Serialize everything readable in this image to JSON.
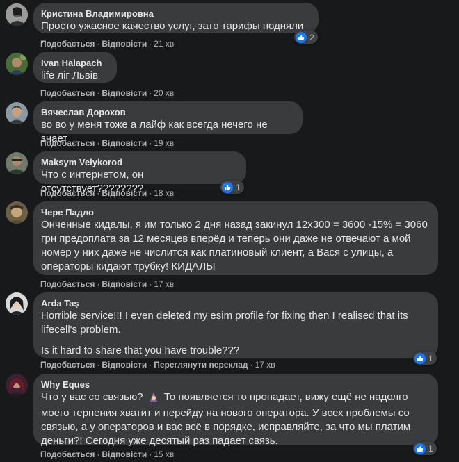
{
  "actions": {
    "like": "Подобається",
    "reply": "Відповісти",
    "translate": "Переглянути переклад",
    "sep": "·"
  },
  "comments": [
    {
      "author": "Кристина Владимировна",
      "text": "Просто ужасное качество услуг, зато тарифы подняли ...",
      "time": "21 хв",
      "reactions": "2"
    },
    {
      "author": "Ivan Halapach",
      "text": "life ліг Львів",
      "time": "20 хв"
    },
    {
      "author": "Вячеслав Дорохов",
      "text": "во во у меня тоже а лайф как всегда нечего не знает",
      "time": "19 хв"
    },
    {
      "author": "Maksym Velykorod",
      "text": "Что с интернетом, он отсутствует????????",
      "time": "18 хв",
      "reactions": "1"
    },
    {
      "author": "Чере Падло",
      "text": "Онченные кидалы, я им только 2 дня назад закинул 12х300 = 3600 -15% = 3060 грн предоплата за 12 месяцев вперёд и теперь они даже не отвечают а мой номер у них даже не числится как платиновый клиент, а Вася с улицы, а операторы кидают трубку! КИДАЛЫ",
      "time": "17 хв"
    },
    {
      "author": "Arda Taş",
      "text": "Horrible service!!! I even deleted my esim profile for fixing then I realised that its lifecell's problem.",
      "text2": "Is it hard to share that you have trouble???",
      "time": "17 хв",
      "reactions": "1"
    },
    {
      "author": "Why Eques",
      "text_a": "Что у вас со связью?",
      "text_b": "То появляется то пропадает, вижу ещё не надолго моего терпения хватит и перейду на нового оператора. У всех проблемы со связью, а у операторов и вас всё в порядке, исправляйте, за что мы платим деньги?! Сегодня уже десятый раз падает связь.",
      "emoji": "woman-mage-emoji",
      "time": "15 хв",
      "reactions": "1"
    }
  ],
  "colors": {
    "background": "#18191a",
    "bubble": "#3a3b3c",
    "like_blue": "#1877f2"
  }
}
